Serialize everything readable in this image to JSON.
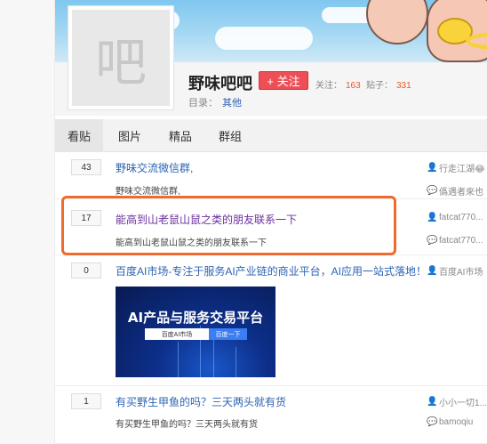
{
  "forum": {
    "avatar_char": "吧",
    "name": "野味吧吧",
    "follow_label": "+ 关注",
    "follow_stat_label": "关注：",
    "follow_count": "163",
    "post_stat_label": "贴子：",
    "post_count": "331",
    "catalog_label": "目录：",
    "catalog_value": "其他"
  },
  "tabs": [
    {
      "label": "看贴",
      "active": true
    },
    {
      "label": "图片",
      "active": false
    },
    {
      "label": "精品",
      "active": false
    },
    {
      "label": "群组",
      "active": false
    }
  ],
  "threads": [
    {
      "replies": "43",
      "title": "野味交流微信群,",
      "abstract": "野味交流微信群,",
      "author": "行走江湖😂",
      "last_reply": "僞遇者來也"
    },
    {
      "replies": "17",
      "title": "能高到山老鼠山鼠之类的朋友联系一下",
      "abstract": "能高到山老鼠山鼠之类的朋友联系一下",
      "author": "fatcat770...",
      "last_reply": "fatcat770..."
    },
    {
      "replies": "0",
      "title": "百度AI市场-专注于服务AI产业链的商业平台，AI应用一站式落地！",
      "author": "百度AI市场",
      "ad": {
        "headline": "AI产品与服务交易平台",
        "left_label": "百度AI市场",
        "right_label": "百度一下"
      }
    },
    {
      "replies": "1",
      "title": "有买野生甲鱼的吗？三天两头就有货",
      "abstract": "有买野生甲鱼的吗？三天两头就有货",
      "author": "小小一切1...",
      "last_reply": "bamoqiu"
    }
  ],
  "colors": {
    "accent_red": "#ee4e56",
    "link_blue": "#2d64b3",
    "highlight_orange": "#ef6a2d"
  }
}
